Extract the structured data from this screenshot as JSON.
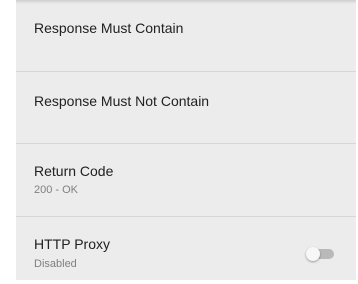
{
  "settings": {
    "items": [
      {
        "title": "Response Must Contain",
        "subtitle": ""
      },
      {
        "title": "Response Must Not Contain",
        "subtitle": ""
      },
      {
        "title": "Return Code",
        "subtitle": "200 - OK"
      },
      {
        "title": "HTTP Proxy",
        "subtitle": "Disabled",
        "toggle_on": false
      }
    ]
  },
  "colors": {
    "panel_background": "#ececec",
    "divider": "#d6d6d6",
    "title_text": "#212121",
    "subtitle_text": "#808080",
    "toggle_track_off": "#b9b9b9",
    "toggle_thumb_off": "#f7f7f7"
  },
  "icons": {
    "toggle": "switch-off"
  }
}
